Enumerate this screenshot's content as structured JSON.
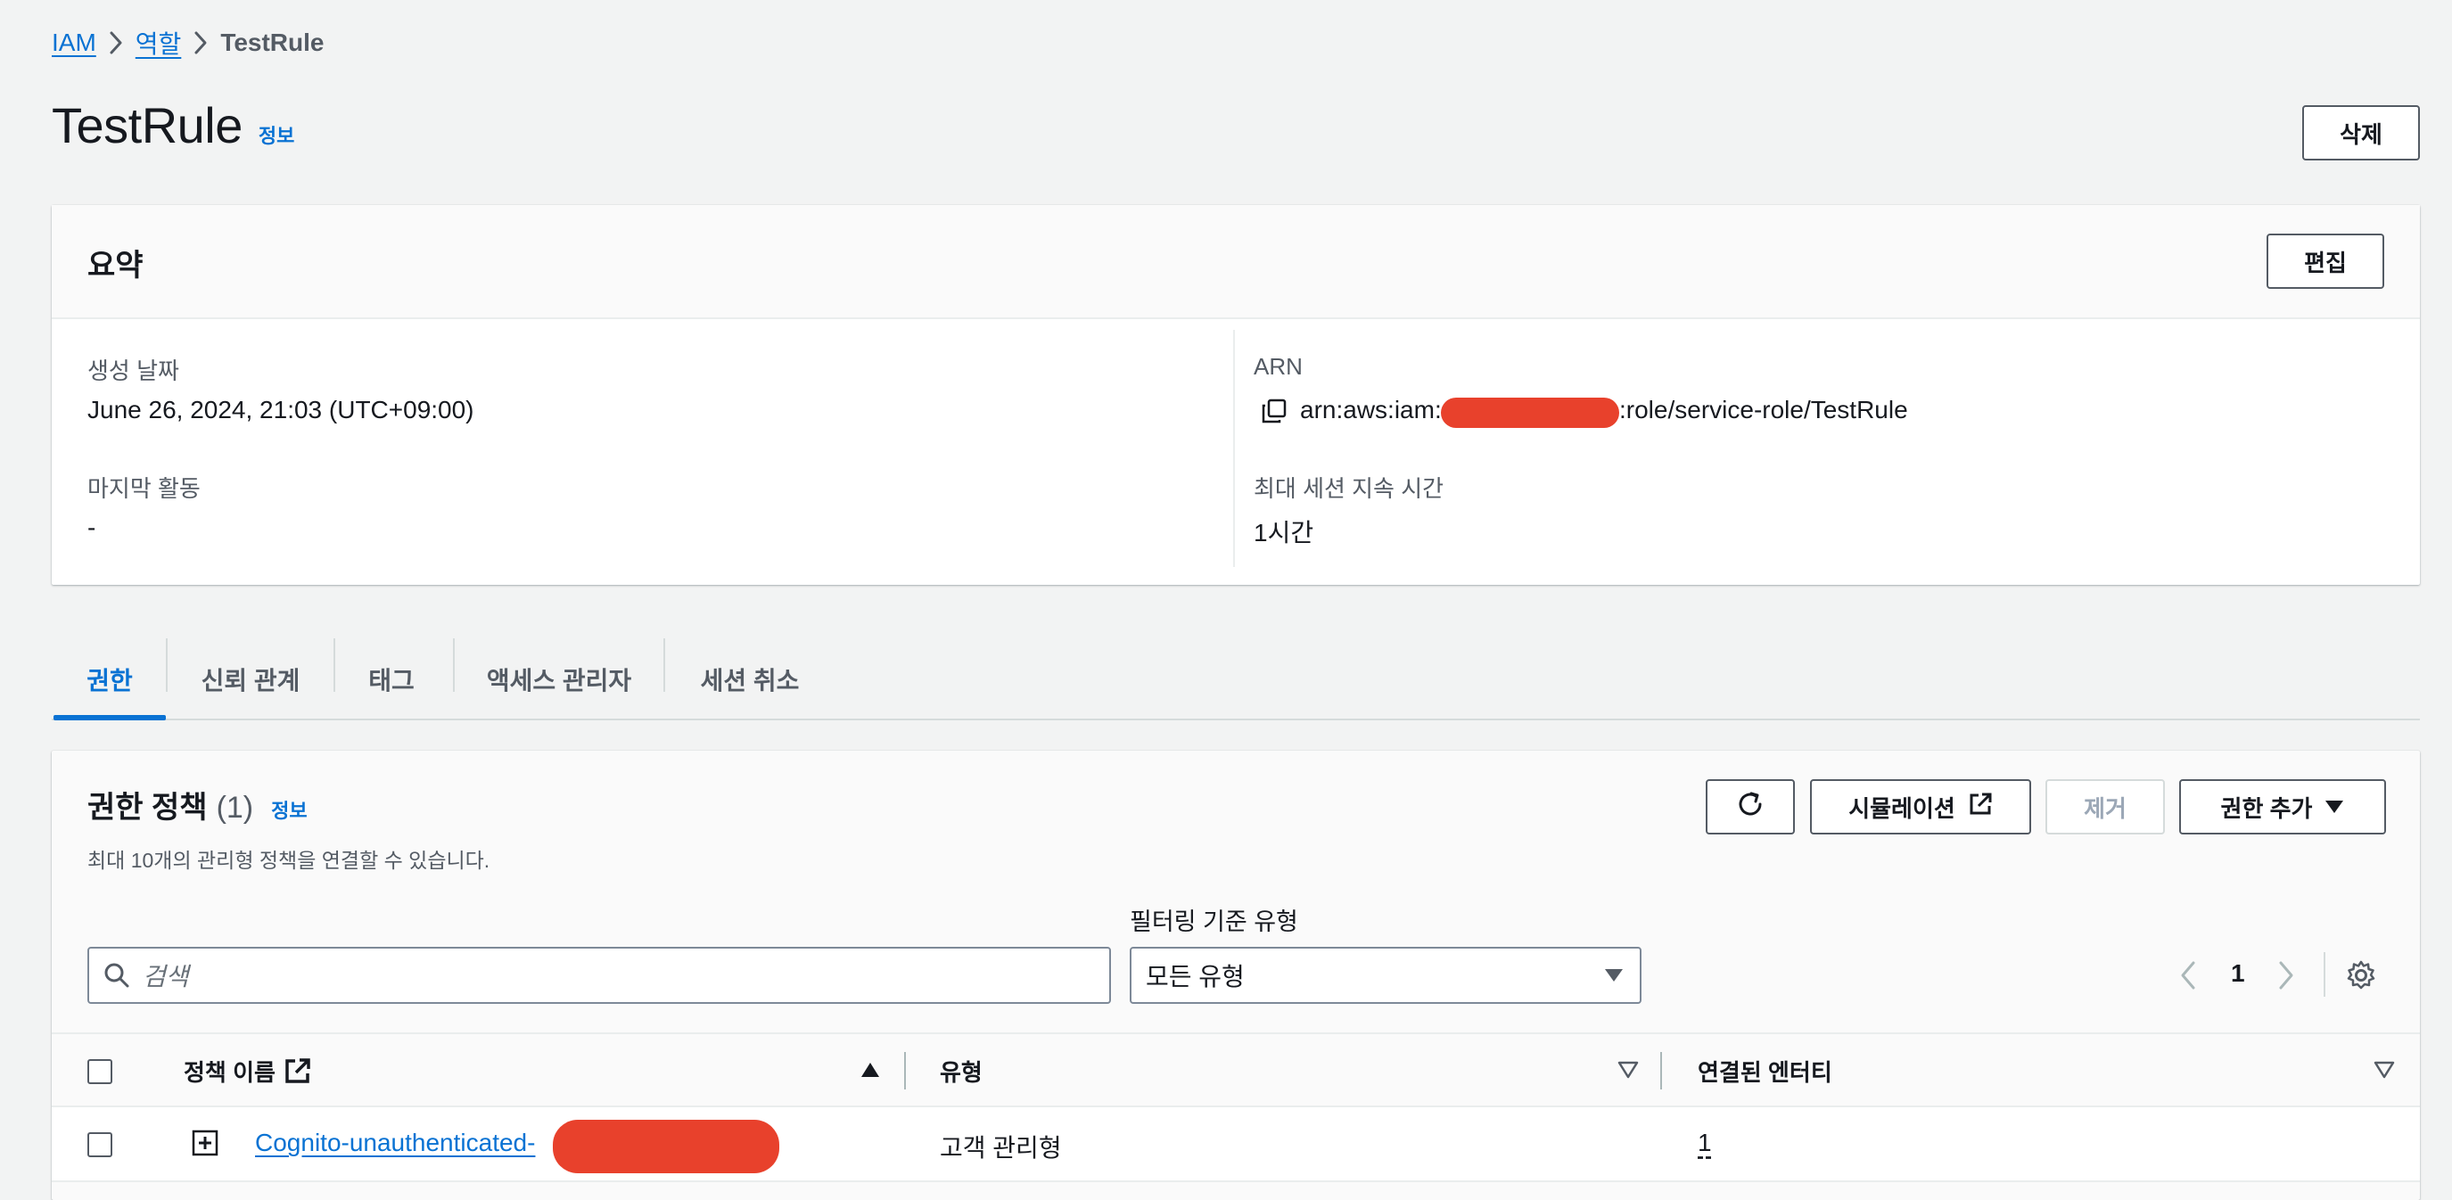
{
  "breadcrumb": {
    "items": [
      {
        "label": "IAM"
      },
      {
        "label": "역할"
      },
      {
        "label": "TestRule"
      }
    ]
  },
  "page": {
    "title": "TestRule",
    "info_label": "정보",
    "delete_label": "삭제"
  },
  "summary": {
    "heading": "요약",
    "edit_label": "편집",
    "created_label": "생성 날짜",
    "created_value": "June 26, 2024, 21:03 (UTC+09:00)",
    "last_activity_label": "마지막 활동",
    "last_activity_value": "-",
    "arn_label": "ARN",
    "arn_prefix": "arn:aws:iam::",
    "arn_suffix": ":role/service-role/TestRule",
    "max_session_label": "최대 세션 지속 시간",
    "max_session_value": "1시간"
  },
  "tabs": [
    {
      "label": "권한",
      "active": true
    },
    {
      "label": "신뢰 관계",
      "active": false
    },
    {
      "label": "태그",
      "active": false
    },
    {
      "label": "액세스 관리자",
      "active": false
    },
    {
      "label": "세션 취소",
      "active": false
    }
  ],
  "permissions": {
    "title": "권한 정책",
    "count": "(1)",
    "info_label": "정보",
    "description": "최대 10개의 관리형 정책을 연결할 수 있습니다.",
    "simulate_label": "시뮬레이션",
    "remove_label": "제거",
    "add_label": "권한 추가",
    "filter_label": "필터링 기준 유형",
    "search_placeholder": "검색",
    "filter_value": "모든 유형",
    "page_number": "1",
    "columns": {
      "name": "정책 이름",
      "type": "유형",
      "entities": "연결된 엔터티"
    },
    "rows": [
      {
        "name": "Cognito-unauthenticated-",
        "type": "고객 관리형",
        "entities": "1"
      }
    ]
  },
  "colors": {
    "accent": "#0972d3",
    "redaction": "#e8412c"
  }
}
